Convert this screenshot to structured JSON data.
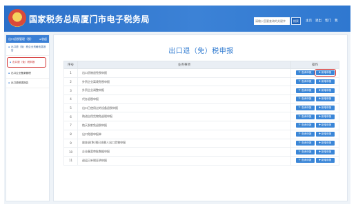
{
  "header": {
    "title": "国家税务总局厦门市电子税务局",
    "search_placeholder": "请输入您要查询的关键字",
    "search_button": "搜索",
    "links": [
      "主页",
      "退出",
      "帮门",
      "我"
    ]
  },
  "sidebar": {
    "head_label": "出口退税管理（税）",
    "head_action": "◂ 收起",
    "items": [
      {
        "label": "出口退（免）税企业资格信息报告",
        "active": false
      },
      {
        "label": "出口退（免）税申报",
        "active": true
      },
      {
        "label": "出口企业备案管理",
        "active": false
      },
      {
        "label": "出口退税类报告",
        "active": false
      }
    ]
  },
  "main": {
    "title": "出口退（免）税申报",
    "columns": [
      "序号",
      "业务事项",
      "操作"
    ],
    "rows": [
      {
        "num": "1",
        "name": "出口货物退免税申报"
      },
      {
        "num": "2",
        "name": "外贸企业离境免税申报"
      },
      {
        "num": "3",
        "name": "外贸企业调整申报"
      },
      {
        "num": "4",
        "name": "代办退税申报"
      },
      {
        "num": "5",
        "name": "出口已使用过的设备退税申报"
      },
      {
        "num": "6",
        "name": "购进自用货物免退税申报"
      },
      {
        "num": "7",
        "name": "航天发射免退税申报"
      },
      {
        "num": "8",
        "name": "出口免税申报单"
      },
      {
        "num": "9",
        "name": "放弃退(免)税已由税人出口货物申报"
      },
      {
        "num": "10",
        "name": "企业备案审批数据申报"
      },
      {
        "num": "11",
        "name": "退运已补税证明申报"
      }
    ],
    "buttons": {
      "query": "🔍查询申报",
      "new": "✚ 新增申报"
    },
    "highlight_row": 0
  }
}
